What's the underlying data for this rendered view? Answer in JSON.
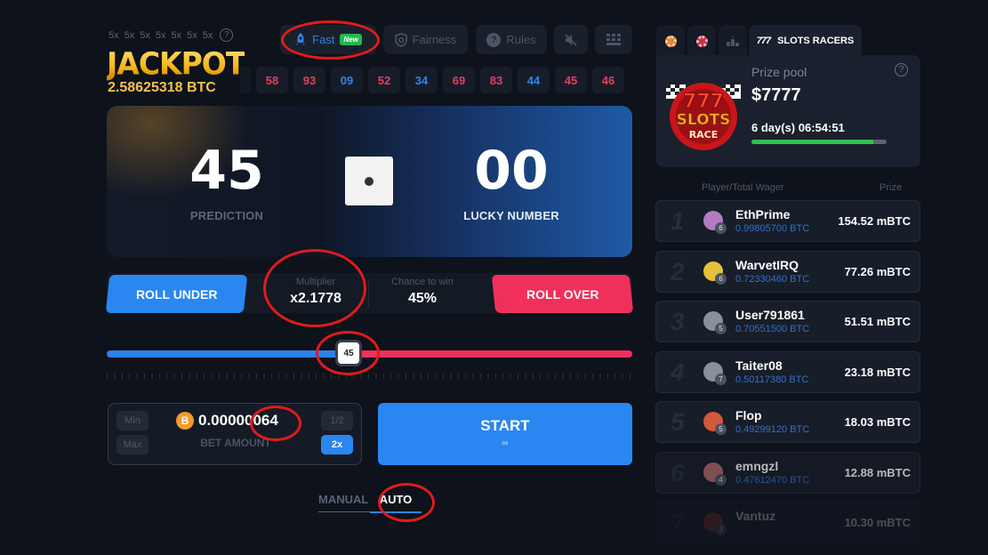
{
  "jackpot": {
    "multipliers": [
      "5x",
      "5x",
      "5x",
      "5x",
      "5x",
      "5x",
      "5x"
    ],
    "title": "JACKPOT",
    "amount": "2.58625318 BTC",
    "help_icon": "question-circle-icon"
  },
  "topbar": {
    "fast_label": "Fast",
    "fast_badge": "New",
    "fairness_label": "Fairness",
    "rules_label": "Rules",
    "fast_icon": "rocket-icon",
    "fairness_icon": "shield-icon",
    "rules_icon": "question-circle-icon",
    "mute_icon": "speaker-muted-icon",
    "grid_icon": "grid-icon"
  },
  "history": [
    {
      "value": "58",
      "color": "red"
    },
    {
      "value": "93",
      "color": "red"
    },
    {
      "value": "09",
      "color": "blue"
    },
    {
      "value": "52",
      "color": "red"
    },
    {
      "value": "34",
      "color": "blue"
    },
    {
      "value": "69",
      "color": "red"
    },
    {
      "value": "83",
      "color": "red"
    },
    {
      "value": "44",
      "color": "blue"
    },
    {
      "value": "45",
      "color": "red"
    },
    {
      "value": "46",
      "color": "red"
    }
  ],
  "game": {
    "prediction": "45",
    "prediction_label": "PREDICTION",
    "lucky_number": "00",
    "lucky_label": "LUCKY NUMBER",
    "roll_under": "ROLL UNDER",
    "roll_over": "ROLL OVER",
    "multiplier_label": "Multiplier",
    "multiplier_value": "x2.1778",
    "chance_label": "Chance to win",
    "chance_value": "45%",
    "slider_value": "45",
    "slider_max": 100
  },
  "bet": {
    "min": "Min",
    "max": "Max",
    "half": "1/2",
    "double": "2x",
    "currency_symbol": "B",
    "amount": "0.00000064",
    "label": "BET AMOUNT"
  },
  "start": {
    "label": "START",
    "sub": "∞"
  },
  "modes": {
    "manual": "MANUAL",
    "auto": "AUTO",
    "active": "auto"
  },
  "sidebar": {
    "tabs": [
      "chip-orange-icon",
      "chip-red-icon",
      "podium-icon"
    ],
    "active_tab": "SLOTS RACERS",
    "active_tab_icon": "777",
    "prize_pool_label": "Prize pool",
    "prize_pool_value": "$7777",
    "timer": "6 day(s) 06:54:51",
    "timer_progress": 0.9,
    "logo": {
      "top": "777",
      "mid": "SLOTS",
      "bottom": "RACE"
    },
    "header_player": "Player/Total Wager",
    "header_prize": "Prize",
    "leaders": [
      {
        "rank": "1",
        "name": "EthPrime",
        "wager": "0.99805700 BTC",
        "prize": "154.52 mBTC",
        "level": "6",
        "avatar_color": "#b37bc4"
      },
      {
        "rank": "2",
        "name": "WarvetIRQ",
        "wager": "0.72330460 BTC",
        "prize": "77.26 mBTC",
        "level": "6",
        "avatar_color": "#e2c23a"
      },
      {
        "rank": "3",
        "name": "User791861",
        "wager": "0.70551500 BTC",
        "prize": "51.51 mBTC",
        "level": "5",
        "avatar_color": "#8a8f98"
      },
      {
        "rank": "4",
        "name": "Taiter08",
        "wager": "0.50117380 BTC",
        "prize": "23.18 mBTC",
        "level": "7",
        "avatar_color": "#8a8f98"
      },
      {
        "rank": "5",
        "name": "Flop",
        "wager": "0.49299120 BTC",
        "prize": "18.03 mBTC",
        "level": "5",
        "avatar_color": "#d4583c"
      },
      {
        "rank": "6",
        "name": "emngzl",
        "wager": "0.47612470 BTC",
        "prize": "12.88 mBTC",
        "level": "4",
        "avatar_color": "#b06a6a"
      },
      {
        "rank": "7",
        "name": "Vantuz",
        "wager": "",
        "prize": "10.30 mBTC",
        "level": "3",
        "avatar_color": "#8a3d2e"
      }
    ]
  },
  "colors": {
    "blue": "#2a86f0",
    "red": "#f0305a",
    "green": "#2fc34e",
    "gold": "#f3c24d",
    "annotation": "#e01b1b"
  }
}
